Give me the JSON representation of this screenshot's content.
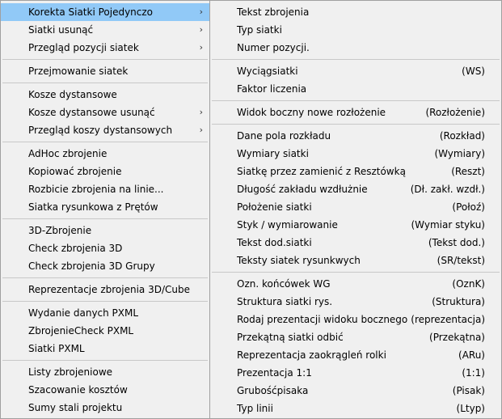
{
  "main_menu": {
    "items": [
      {
        "label": "Korekta Siatki Pojedynczo",
        "submenu": true,
        "highlighted": true
      },
      {
        "label": "Siatki usunąć",
        "submenu": true
      },
      {
        "label": "Przegląd pozycji siatek",
        "submenu": true
      },
      {
        "separator": true
      },
      {
        "label": "Przejmowanie siatek"
      },
      {
        "separator": true
      },
      {
        "label": "Kosze dystansowe"
      },
      {
        "label": "Kosze dystansowe usunąć",
        "submenu": true
      },
      {
        "label": "Przegląd koszy dystansowych",
        "submenu": true
      },
      {
        "separator": true
      },
      {
        "label": "AdHoc zbrojenie"
      },
      {
        "label": "Kopiować zbrojenie"
      },
      {
        "label": "Rozbicie zbrojenia na linie..."
      },
      {
        "label": "Siatka rysunkowa z Prętów"
      },
      {
        "separator": true
      },
      {
        "label": "3D-Zbrojenie"
      },
      {
        "label": "Check zbrojenia 3D"
      },
      {
        "label": "Check zbrojenia 3D Grupy"
      },
      {
        "separator": true
      },
      {
        "label": "Reprezentacje zbrojenia 3D/Cube"
      },
      {
        "separator": true
      },
      {
        "label": "Wydanie danych PXML"
      },
      {
        "label": "ZbrojenieCheck PXML"
      },
      {
        "label": "Siatki PXML"
      },
      {
        "separator": true
      },
      {
        "label": "Listy zbrojeniowe"
      },
      {
        "label": "Szacowanie kosztów"
      },
      {
        "label": "Sumy stali projektu"
      }
    ],
    "submenu_arrow": "›",
    "highlight_color": "#91c9f7"
  },
  "sub_menu": {
    "items": [
      {
        "label": "Tekst zbrojenia",
        "shortcut": ""
      },
      {
        "label": "Typ siatki",
        "shortcut": ""
      },
      {
        "label": "Numer pozycji.",
        "shortcut": ""
      },
      {
        "separator": true
      },
      {
        "label": "Wyciągsiatki",
        "shortcut": "(WS)"
      },
      {
        "label": "Faktor liczenia",
        "shortcut": ""
      },
      {
        "separator": true
      },
      {
        "label": "Widok boczny nowe rozłożenie",
        "shortcut": "(Rozłożenie)"
      },
      {
        "separator": true
      },
      {
        "label": "Dane pola rozkładu",
        "shortcut": "(Rozkład)"
      },
      {
        "label": "Wymiary siatki",
        "shortcut": "(Wymiary)"
      },
      {
        "label": "Siatkę przez zamienić z Resztówką",
        "shortcut": "(Reszt)"
      },
      {
        "label": "Długość zakładu wzdłużnie",
        "shortcut": "(Dł. zakł. wzdł.)"
      },
      {
        "label": "Położenie siatki",
        "shortcut": "(Połoź)"
      },
      {
        "label": "Styk / wymiarowanie",
        "shortcut": "(Wymiar styku)"
      },
      {
        "label": "Tekst dod.siatki",
        "shortcut": "(Tekst dod.)"
      },
      {
        "label": "Teksty siatek rysunkwych",
        "shortcut": "(SR/tekst)"
      },
      {
        "separator": true
      },
      {
        "label": "Ozn. końcówek WG",
        "shortcut": "(OznK)"
      },
      {
        "label": "Struktura siatki rys.",
        "shortcut": "(Struktura)"
      },
      {
        "label": "Rodaj prezentacji widoku bocznego",
        "shortcut": "(reprezentacja)"
      },
      {
        "label": "Przekątną siatki odbić",
        "shortcut": "(Przekątna)"
      },
      {
        "label": "Reprezentacja zaokrągleń rolki",
        "shortcut": "(ARu)"
      },
      {
        "label": "Prezentacja 1:1",
        "shortcut": "(1:1)"
      },
      {
        "label": "Grubośćpisaka",
        "shortcut": "(Pisak)"
      },
      {
        "label": "Typ linii",
        "shortcut": "(Ltyp)"
      }
    ]
  }
}
